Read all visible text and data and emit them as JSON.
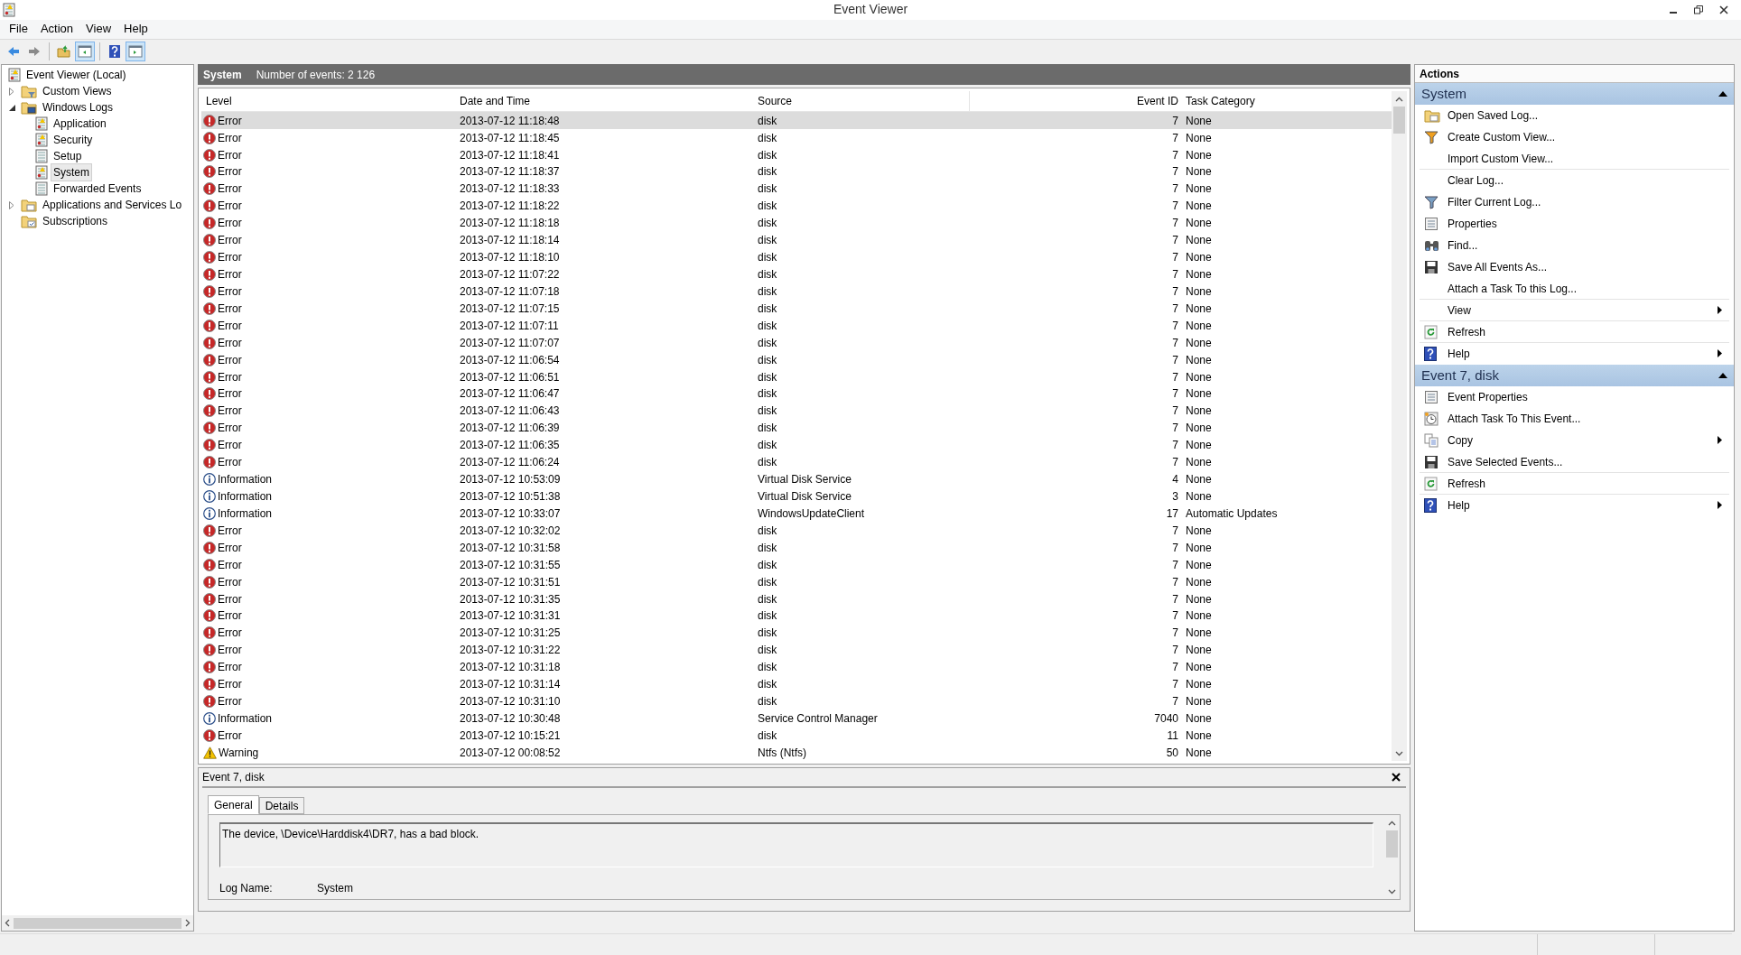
{
  "window": {
    "title": "Event Viewer"
  },
  "menu": [
    "File",
    "Action",
    "View",
    "Help"
  ],
  "toolbar": [
    {
      "pressed": false
    },
    {
      "pressed": false
    },
    {
      "pressed": false
    },
    {
      "pressed": true
    },
    {
      "pressed": false
    },
    {
      "pressed": true
    }
  ],
  "tree": [
    {
      "label": "Event Viewer (Local)",
      "kind": "log",
      "selected": false,
      "children": [
        {
          "label": "Custom Views",
          "kind": "filter-folder",
          "expanded": false,
          "selected": false
        },
        {
          "label": "Windows Logs",
          "kind": "monitor-folder",
          "expanded": true,
          "selected": false,
          "children": [
            {
              "label": "Application",
              "kind": "log",
              "selected": false
            },
            {
              "label": "Security",
              "kind": "log",
              "selected": false
            },
            {
              "label": "Setup",
              "kind": "plain-log",
              "selected": false
            },
            {
              "label": "System",
              "kind": "log",
              "selected": true
            },
            {
              "label": "Forwarded Events",
              "kind": "plain-log",
              "selected": false
            }
          ]
        },
        {
          "label": "Applications and Services Lo",
          "kind": "folder",
          "expanded": false,
          "selected": false
        },
        {
          "label": "Subscriptions",
          "kind": "subscription-folder",
          "selected": false
        }
      ]
    }
  ],
  "log_header": {
    "name": "System",
    "count": "Number of events: 2 126"
  },
  "table": {
    "columns": [
      "Level",
      "Date and Time",
      "Source",
      "Event ID",
      "Task Category"
    ],
    "rows": [
      {
        "kind": "error",
        "level": "Error",
        "date": "2013-07-12 11:18:48",
        "source": "disk",
        "id": "7",
        "category": "None",
        "selected": true
      },
      {
        "kind": "error",
        "level": "Error",
        "date": "2013-07-12 11:18:45",
        "source": "disk",
        "id": "7",
        "category": "None",
        "selected": false
      },
      {
        "kind": "error",
        "level": "Error",
        "date": "2013-07-12 11:18:41",
        "source": "disk",
        "id": "7",
        "category": "None",
        "selected": false
      },
      {
        "kind": "error",
        "level": "Error",
        "date": "2013-07-12 11:18:37",
        "source": "disk",
        "id": "7",
        "category": "None",
        "selected": false
      },
      {
        "kind": "error",
        "level": "Error",
        "date": "2013-07-12 11:18:33",
        "source": "disk",
        "id": "7",
        "category": "None",
        "selected": false
      },
      {
        "kind": "error",
        "level": "Error",
        "date": "2013-07-12 11:18:22",
        "source": "disk",
        "id": "7",
        "category": "None",
        "selected": false
      },
      {
        "kind": "error",
        "level": "Error",
        "date": "2013-07-12 11:18:18",
        "source": "disk",
        "id": "7",
        "category": "None",
        "selected": false
      },
      {
        "kind": "error",
        "level": "Error",
        "date": "2013-07-12 11:18:14",
        "source": "disk",
        "id": "7",
        "category": "None",
        "selected": false
      },
      {
        "kind": "error",
        "level": "Error",
        "date": "2013-07-12 11:18:10",
        "source": "disk",
        "id": "7",
        "category": "None",
        "selected": false
      },
      {
        "kind": "error",
        "level": "Error",
        "date": "2013-07-12 11:07:22",
        "source": "disk",
        "id": "7",
        "category": "None",
        "selected": false
      },
      {
        "kind": "error",
        "level": "Error",
        "date": "2013-07-12 11:07:18",
        "source": "disk",
        "id": "7",
        "category": "None",
        "selected": false
      },
      {
        "kind": "error",
        "level": "Error",
        "date": "2013-07-12 11:07:15",
        "source": "disk",
        "id": "7",
        "category": "None",
        "selected": false
      },
      {
        "kind": "error",
        "level": "Error",
        "date": "2013-07-12 11:07:11",
        "source": "disk",
        "id": "7",
        "category": "None",
        "selected": false
      },
      {
        "kind": "error",
        "level": "Error",
        "date": "2013-07-12 11:07:07",
        "source": "disk",
        "id": "7",
        "category": "None",
        "selected": false
      },
      {
        "kind": "error",
        "level": "Error",
        "date": "2013-07-12 11:06:54",
        "source": "disk",
        "id": "7",
        "category": "None",
        "selected": false
      },
      {
        "kind": "error",
        "level": "Error",
        "date": "2013-07-12 11:06:51",
        "source": "disk",
        "id": "7",
        "category": "None",
        "selected": false
      },
      {
        "kind": "error",
        "level": "Error",
        "date": "2013-07-12 11:06:47",
        "source": "disk",
        "id": "7",
        "category": "None",
        "selected": false
      },
      {
        "kind": "error",
        "level": "Error",
        "date": "2013-07-12 11:06:43",
        "source": "disk",
        "id": "7",
        "category": "None",
        "selected": false
      },
      {
        "kind": "error",
        "level": "Error",
        "date": "2013-07-12 11:06:39",
        "source": "disk",
        "id": "7",
        "category": "None",
        "selected": false
      },
      {
        "kind": "error",
        "level": "Error",
        "date": "2013-07-12 11:06:35",
        "source": "disk",
        "id": "7",
        "category": "None",
        "selected": false
      },
      {
        "kind": "error",
        "level": "Error",
        "date": "2013-07-12 11:06:24",
        "source": "disk",
        "id": "7",
        "category": "None",
        "selected": false
      },
      {
        "kind": "information",
        "level": "Information",
        "date": "2013-07-12 10:53:09",
        "source": "Virtual Disk Service",
        "id": "4",
        "category": "None",
        "selected": false
      },
      {
        "kind": "information",
        "level": "Information",
        "date": "2013-07-12 10:51:38",
        "source": "Virtual Disk Service",
        "id": "3",
        "category": "None",
        "selected": false
      },
      {
        "kind": "information",
        "level": "Information",
        "date": "2013-07-12 10:33:07",
        "source": "WindowsUpdateClient",
        "id": "17",
        "category": "Automatic Updates",
        "selected": false
      },
      {
        "kind": "error",
        "level": "Error",
        "date": "2013-07-12 10:32:02",
        "source": "disk",
        "id": "7",
        "category": "None",
        "selected": false
      },
      {
        "kind": "error",
        "level": "Error",
        "date": "2013-07-12 10:31:58",
        "source": "disk",
        "id": "7",
        "category": "None",
        "selected": false
      },
      {
        "kind": "error",
        "level": "Error",
        "date": "2013-07-12 10:31:55",
        "source": "disk",
        "id": "7",
        "category": "None",
        "selected": false
      },
      {
        "kind": "error",
        "level": "Error",
        "date": "2013-07-12 10:31:51",
        "source": "disk",
        "id": "7",
        "category": "None",
        "selected": false
      },
      {
        "kind": "error",
        "level": "Error",
        "date": "2013-07-12 10:31:35",
        "source": "disk",
        "id": "7",
        "category": "None",
        "selected": false
      },
      {
        "kind": "error",
        "level": "Error",
        "date": "2013-07-12 10:31:31",
        "source": "disk",
        "id": "7",
        "category": "None",
        "selected": false
      },
      {
        "kind": "error",
        "level": "Error",
        "date": "2013-07-12 10:31:25",
        "source": "disk",
        "id": "7",
        "category": "None",
        "selected": false
      },
      {
        "kind": "error",
        "level": "Error",
        "date": "2013-07-12 10:31:22",
        "source": "disk",
        "id": "7",
        "category": "None",
        "selected": false
      },
      {
        "kind": "error",
        "level": "Error",
        "date": "2013-07-12 10:31:18",
        "source": "disk",
        "id": "7",
        "category": "None",
        "selected": false
      },
      {
        "kind": "error",
        "level": "Error",
        "date": "2013-07-12 10:31:14",
        "source": "disk",
        "id": "7",
        "category": "None",
        "selected": false
      },
      {
        "kind": "error",
        "level": "Error",
        "date": "2013-07-12 10:31:10",
        "source": "disk",
        "id": "7",
        "category": "None",
        "selected": false
      },
      {
        "kind": "information",
        "level": "Information",
        "date": "2013-07-12 10:30:48",
        "source": "Service Control Manager",
        "id": "7040",
        "category": "None",
        "selected": false
      },
      {
        "kind": "error",
        "level": "Error",
        "date": "2013-07-12 10:15:21",
        "source": "disk",
        "id": "11",
        "category": "None",
        "selected": false
      },
      {
        "kind": "warning",
        "level": "Warning",
        "date": "2013-07-12 00:08:52",
        "source": "Ntfs (Ntfs)",
        "id": "50",
        "category": "None",
        "selected": false
      }
    ]
  },
  "detail": {
    "title": "Event 7, disk",
    "tabs": [
      {
        "label": "General",
        "selected": true
      },
      {
        "label": "Details",
        "selected": false
      }
    ],
    "message": "The device, \\Device\\Harddisk4\\DR7, has a bad block.",
    "fields": [
      {
        "label": "Log Name:",
        "value": "System"
      }
    ]
  },
  "actions": {
    "title": "Actions",
    "sections": [
      {
        "title": "System",
        "expanded": true,
        "items": [
          {
            "label": "Open Saved Log...",
            "kind": "folder",
            "submenu": false,
            "divider_after": false
          },
          {
            "label": "Create Custom View...",
            "kind": "colorfunnel",
            "submenu": false,
            "divider_after": false
          },
          {
            "label": "Import Custom View...",
            "kind": "plain",
            "submenu": false,
            "divider_after": true
          },
          {
            "label": "Clear Log...",
            "kind": "plain",
            "submenu": false,
            "divider_after": false
          },
          {
            "label": "Filter Current Log...",
            "kind": "funnel",
            "submenu": false,
            "divider_after": false
          },
          {
            "label": "Properties",
            "kind": "properties",
            "submenu": false,
            "divider_after": false
          },
          {
            "label": "Find...",
            "kind": "binoculars",
            "submenu": false,
            "divider_after": false
          },
          {
            "label": "Save All Events As...",
            "kind": "floppy",
            "submenu": false,
            "divider_after": false
          },
          {
            "label": "Attach a Task To this Log...",
            "kind": "plain",
            "submenu": false,
            "divider_after": true
          },
          {
            "label": "View",
            "kind": "plain",
            "submenu": true,
            "divider_after": true
          },
          {
            "label": "Refresh",
            "kind": "refresh",
            "submenu": false,
            "divider_after": true
          },
          {
            "label": "Help",
            "kind": "help",
            "submenu": true,
            "divider_after": false
          }
        ]
      },
      {
        "title": "Event 7, disk",
        "expanded": true,
        "items": [
          {
            "label": "Event Properties",
            "kind": "properties",
            "submenu": false,
            "divider_after": false
          },
          {
            "label": "Attach Task To This Event...",
            "kind": "clock",
            "submenu": false,
            "divider_after": false
          },
          {
            "label": "Copy",
            "kind": "copy",
            "submenu": true,
            "divider_after": false
          },
          {
            "label": "Save Selected Events...",
            "kind": "floppy",
            "submenu": false,
            "divider_after": true
          },
          {
            "label": "Refresh",
            "kind": "refresh",
            "submenu": false,
            "divider_after": true
          },
          {
            "label": "Help",
            "kind": "help",
            "submenu": true,
            "divider_after": false
          }
        ]
      }
    ]
  }
}
